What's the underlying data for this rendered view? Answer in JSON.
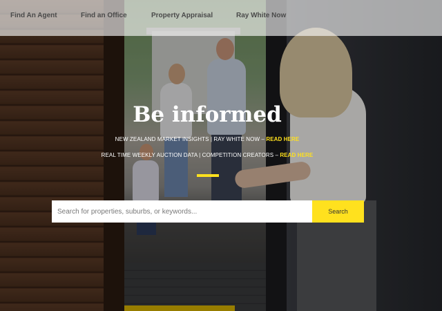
{
  "nav": {
    "items": [
      {
        "label": "Find An Agent"
      },
      {
        "label": "Find an Office"
      },
      {
        "label": "Property Appraisal"
      },
      {
        "label": "Ray White Now"
      }
    ]
  },
  "hero": {
    "title": "Be informed",
    "line1": {
      "text": "NEW ZEALAND MARKET INSIGHTS | RAY WHITE NOW – ",
      "link": "READ HERE"
    },
    "line2": {
      "text": "REAL TIME WEEKLY AUCTION DATA | COMPETITION CREATORS – ",
      "link": "READ HERE"
    },
    "accent_color": "#ffe11e"
  },
  "search": {
    "placeholder": "Search for properties, suburbs, or keywords...",
    "value": "",
    "button_label": "Search"
  }
}
